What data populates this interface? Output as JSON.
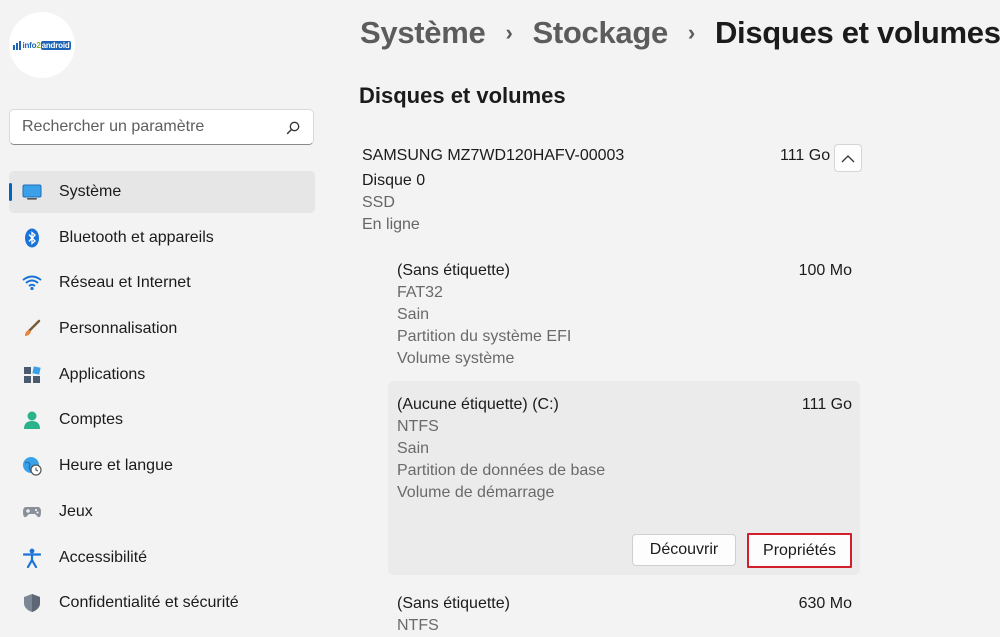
{
  "sidebar": {
    "logo": {
      "part1": "info",
      "part2": "2",
      "part3": "android"
    },
    "search": {
      "placeholder": "Rechercher un paramètre"
    },
    "items": [
      {
        "label": "Système",
        "icon": "monitor-icon"
      },
      {
        "label": "Bluetooth et appareils",
        "icon": "bluetooth-icon"
      },
      {
        "label": "Réseau et Internet",
        "icon": "wifi-icon"
      },
      {
        "label": "Personnalisation",
        "icon": "brush-icon"
      },
      {
        "label": "Applications",
        "icon": "apps-icon"
      },
      {
        "label": "Comptes",
        "icon": "person-icon"
      },
      {
        "label": "Heure et langue",
        "icon": "globe-clock-icon"
      },
      {
        "label": "Jeux",
        "icon": "gamepad-icon"
      },
      {
        "label": "Accessibilité",
        "icon": "accessibility-icon"
      },
      {
        "label": "Confidentialité et sécurité",
        "icon": "shield-icon"
      }
    ]
  },
  "breadcrumb": [
    "Système",
    "Stockage",
    "Disques et volumes"
  ],
  "breadcrumb_separator": "›",
  "section_title": "Disques et volumes",
  "disk": {
    "name": "SAMSUNG MZ7WD120HAFV-00003",
    "size": "111 Go",
    "number": "Disque 0",
    "type": "SSD",
    "status": "En ligne"
  },
  "volumes": [
    {
      "name": "(Sans étiquette)",
      "size": "100 Mo",
      "details": [
        "FAT32",
        "Sain",
        "Partition du système EFI",
        "Volume système"
      ]
    },
    {
      "name": "(Aucune étiquette) (C:)",
      "size": "111 Go",
      "details": [
        "NTFS",
        "Sain",
        "Partition de données de base",
        "Volume de démarrage"
      ],
      "buttons": {
        "explore": "Découvrir",
        "properties": "Propriétés"
      }
    },
    {
      "name": "(Sans étiquette)",
      "size": "630 Mo",
      "details": [
        "NTFS"
      ]
    }
  ],
  "colors": {
    "accent": "#0067c0",
    "highlight_border": "#d11f2b",
    "background": "#f3f3f3"
  }
}
